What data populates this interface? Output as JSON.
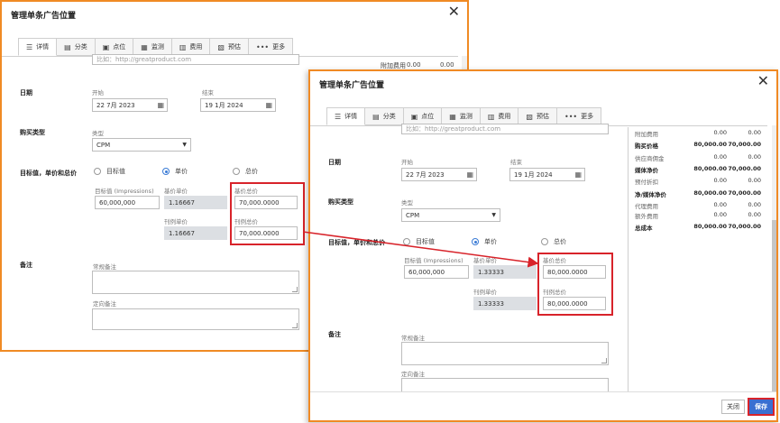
{
  "dialog": {
    "title": "管理单条广告位置",
    "close_symbol": "✕",
    "tabs": [
      {
        "icon": "☰",
        "label": "详情"
      },
      {
        "icon": "▤",
        "label": "分类"
      },
      {
        "icon": "▣",
        "label": "点位"
      },
      {
        "icon": "▦",
        "label": "监测"
      },
      {
        "icon": "▥",
        "label": "费用"
      },
      {
        "icon": "▧",
        "label": "预估"
      },
      {
        "icon": "•••",
        "label": "更多"
      }
    ],
    "url_placeholder": "比如：http://greatproduct.com",
    "date": {
      "section": "日期",
      "start_label": "开始",
      "start_value": "22 7月 2023",
      "end_label": "结束",
      "end_value": "19 1月 2024"
    },
    "buy_type": {
      "section": "购买类型",
      "type_label": "类型",
      "value": "CPM"
    },
    "target": {
      "section": "目标值，单价和总价",
      "opt_target": "目标值",
      "opt_unit": "单价",
      "opt_total": "总价",
      "target_label": "目标值 (Impressions)",
      "base_unit_label": "基价单价",
      "base_total_label": "基价总价",
      "profit_unit_label": "刊例单价",
      "profit_total_label": "刊例总价"
    },
    "notes": {
      "section": "备注",
      "general_label": "常规备注",
      "targeted_label": "定向备注"
    }
  },
  "left": {
    "target_value": "60,000,000",
    "base_unit": "1.16667",
    "base_total": "70,000.0000",
    "profit_unit": "1.16667",
    "profit_total": "70,000.0000",
    "summary_peek": {
      "name": "附加费用",
      "a": "0.00",
      "b": "0.00"
    }
  },
  "right": {
    "target_value": "60,000,000",
    "base_unit": "1.33333",
    "base_total": "80,000.0000",
    "profit_unit": "1.33333",
    "profit_total": "80,000.0000",
    "summary": [
      {
        "name": "附加费用",
        "a": "0.00",
        "b": "0.00",
        "bold": false
      },
      {
        "name": "购买价格",
        "a": "80,000.00",
        "b": "70,000.00",
        "bold": true
      },
      {
        "name": "供应商佣金",
        "a": "0.00",
        "b": "0.00",
        "bold": false
      },
      {
        "name": "媒体净价",
        "a": "80,000.00",
        "b": "70,000.00",
        "bold": true
      },
      {
        "name": "预付折扣",
        "a": "0.00",
        "b": "0.00",
        "bold": false
      },
      {
        "name": "净/媒体净价",
        "a": "80,000.00",
        "b": "70,000.00",
        "bold": true
      },
      {
        "name": "代理费用",
        "a": "0.00",
        "b": "0.00",
        "bold": false
      },
      {
        "name": "额外费用",
        "a": "0.00",
        "b": "0.00",
        "bold": false
      },
      {
        "name": "总成本",
        "a": "80,000.00",
        "b": "70,000.00",
        "bold": true
      }
    ],
    "footer": {
      "close_label": "关闭",
      "save_label": "保存"
    }
  },
  "colors": {
    "accent": "#3a6fd1",
    "highlight": "#d8232a",
    "frame": "#f08a24"
  }
}
